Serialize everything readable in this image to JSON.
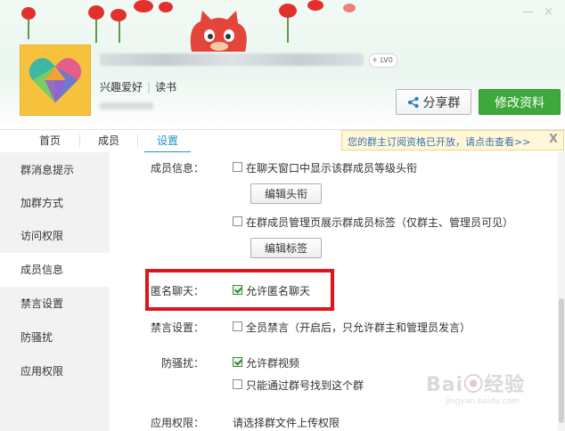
{
  "window": {
    "minimize": "—",
    "close": "×"
  },
  "group": {
    "level_badge": "LV0",
    "tags": [
      "兴趣爱好",
      "读书"
    ]
  },
  "actions": {
    "share_label": "分享群",
    "edit_label": "修改资料"
  },
  "tabs": [
    {
      "label": "首页",
      "active": false
    },
    {
      "label": "成员",
      "active": false
    },
    {
      "label": "设置",
      "active": true
    }
  ],
  "notice": {
    "text": "您的群主订阅资格已开放，请点击查看>>",
    "close": "X"
  },
  "sidebar": {
    "items": [
      {
        "label": "群消息提示",
        "active": false
      },
      {
        "label": "加群方式",
        "active": false
      },
      {
        "label": "访问权限",
        "active": false
      },
      {
        "label": "成员信息",
        "active": true
      },
      {
        "label": "禁言设置",
        "active": false
      },
      {
        "label": "防骚扰",
        "active": false
      },
      {
        "label": "应用权限",
        "active": false
      }
    ]
  },
  "settings": {
    "member_info": {
      "label": "成员信息：",
      "show_title": {
        "text": "在聊天窗口中显示该群成员等级头衔",
        "checked": false
      },
      "edit_title_button": "编辑头衔",
      "show_tags": {
        "text": "在群成员管理页展示群成员标签（仅群主、管理员可见）",
        "checked": false
      },
      "edit_tags_button": "编辑标签"
    },
    "anonymous": {
      "label": "匿名聊天：",
      "allow": {
        "text": "允许匿名聊天",
        "checked": true
      }
    },
    "mute": {
      "label": "禁言设置：",
      "mute_all": {
        "text": "全员禁言（开启后，只允许群主和管理员发言）",
        "checked": false
      }
    },
    "anti_harass": {
      "label": "防骚扰：",
      "allow_video": {
        "text": "允许群视频",
        "checked": true
      },
      "only_by_number": {
        "text": "只能通过群号找到这个群",
        "checked": false
      }
    },
    "app_permission": {
      "label": "应用权限：",
      "text": "请选择群文件上传权限"
    }
  },
  "colors": {
    "accent": "#1f8fd0",
    "primary_button": "#3fa83a",
    "highlight": "#e1141a",
    "notice_bg": "#fff8d6"
  },
  "icons": {
    "share": "share-icon",
    "heart_logo": "heart-avatar-icon"
  }
}
